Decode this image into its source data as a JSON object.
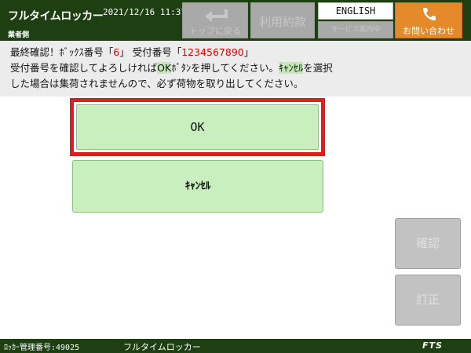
{
  "header": {
    "brand": "フルタイムロッカー",
    "datetime": "2021/12/16 11:37",
    "operator_label": "業者側",
    "top_button_label": "トップに戻る",
    "terms_button_label": "利用約款",
    "english_button_label": "ENGLISH",
    "service_button_label": "サービス案内中",
    "contact_button_label": "お問い合わせ"
  },
  "message": {
    "line1_prefix": "最終確認！ﾎﾞｯｸｽ番号「",
    "box_number": "6",
    "line1_mid": "」 受付番号「",
    "reception_number": "1234567890",
    "line1_suffix": "」",
    "line2_prefix": "受付番号を確認してよろしければ",
    "line2_ok": "OK",
    "line2_mid": "ﾎﾞﾀﾝを押してください。",
    "line2_cancel": "ｷｬﾝｾﾙ",
    "line2_suffix": "を選択",
    "line3": "した場合は集荷されませんので、必ず荷物を取り出してください。"
  },
  "buttons": {
    "ok_label": "OK",
    "cancel_label": "ｷｬﾝｾﾙ",
    "confirm_label": "確認",
    "correct_label": "訂正"
  },
  "footer": {
    "locker_id": "ﾛｯｶｰ管理番号:49025",
    "name": "フルタイムロッカー",
    "logo": "FTS"
  },
  "colors": {
    "header_bg": "#1d3f12",
    "contact_orange": "#e58a2b",
    "ok_highlight_border": "#e21b1b",
    "button_green": "#c9efbf",
    "emphasis_red": "#e00000"
  },
  "icons": {
    "top_button": "return-arrow-icon",
    "contact_button": "phone-icon"
  }
}
